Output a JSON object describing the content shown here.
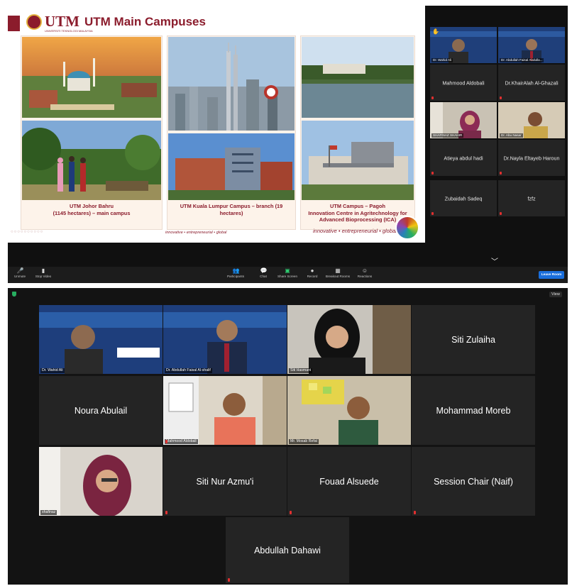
{
  "top_screenshot": {
    "slide": {
      "logo_text": "UTM",
      "logo_subtext": "UNIVERSITI TEKNOLOGI MALAYSIA",
      "title": "UTM Main Campuses",
      "captions": [
        "UTM Johor Bahru\n(1145 hectares) – main campus",
        "UTM Kuala Lumpur Campus – branch (19\nhectares)",
        "UTM Campus – Pagoh\nInnovation Centre in Agritechnology for\nAdvanced Bioprocessing (ICA)"
      ],
      "footer_small": "innovative • entrepreneurial • global",
      "footer_large": "innovative • entrepreneurial • global"
    },
    "participants": [
      {
        "label": "Dr. Wahid Ali",
        "video": true,
        "hand": true
      },
      {
        "label": "Dr. Abdullah Faisal Abdulla...",
        "video": true
      },
      {
        "label": "Mahmood Aldobali"
      },
      {
        "label": "Dr.KhairAlah Al-Ghazali"
      },
      {
        "label": "SHAFINAZ SHAHIR",
        "video": true,
        "active": true
      },
      {
        "label": "Dr. Abu Nasar",
        "video": true
      },
      {
        "label": "Atieya abdul hadi"
      },
      {
        "label": "Dr.Nayla Eltayeb Haroun"
      },
      {
        "label": "Zubaidah Sadeq"
      },
      {
        "label": "fzfz"
      }
    ],
    "toolbar": {
      "unmute": "Unmute",
      "stop_video": "Stop Video",
      "participants": "Participants",
      "participants_count": "72",
      "chat": "Chat",
      "share_screen": "Share Screen",
      "record": "Record",
      "breakout_rooms": "Breakout Rooms",
      "reactions": "Reactions",
      "leave": "Leave Room"
    }
  },
  "bottom_screenshot": {
    "view_label": "View",
    "tiles": [
      {
        "label": "Dr. Wahid Ali",
        "video": true,
        "active": true
      },
      {
        "label": "Dr. Abdullah Faisal Al-shalif",
        "video": true
      },
      {
        "label": "Siti Hasmani",
        "video": true
      },
      {
        "label": "Siti Zulaiha"
      },
      {
        "label": "Noura Abulail"
      },
      {
        "label": "Mahmood Aldobali",
        "video": true
      },
      {
        "label": "Mr. Mosab Refat",
        "video": true
      },
      {
        "label": "Mohammad Moreb"
      },
      {
        "label": "shafinaz",
        "video": true
      },
      {
        "label": "Siti Nur Azmu'i"
      },
      {
        "label": "Fouad Alsuede"
      },
      {
        "label": "Session Chair (Naif)"
      },
      {
        "label": "Abdullah Dahawi"
      }
    ],
    "banner_text": {
      "title_line": "The International Congress of",
      "title_line2": "Advanced Technology and Engineering",
      "year": "(ICATE 2021)",
      "date": "July 4-5, 2021",
      "collab": "International Collaborators:",
      "organizer": "Organizer:"
    }
  },
  "colors": {
    "utm_maroon": "#8b1c2c",
    "active_border": "#c3e05a",
    "leave_button": "#1a6edb",
    "tile_bg": "#242424"
  }
}
